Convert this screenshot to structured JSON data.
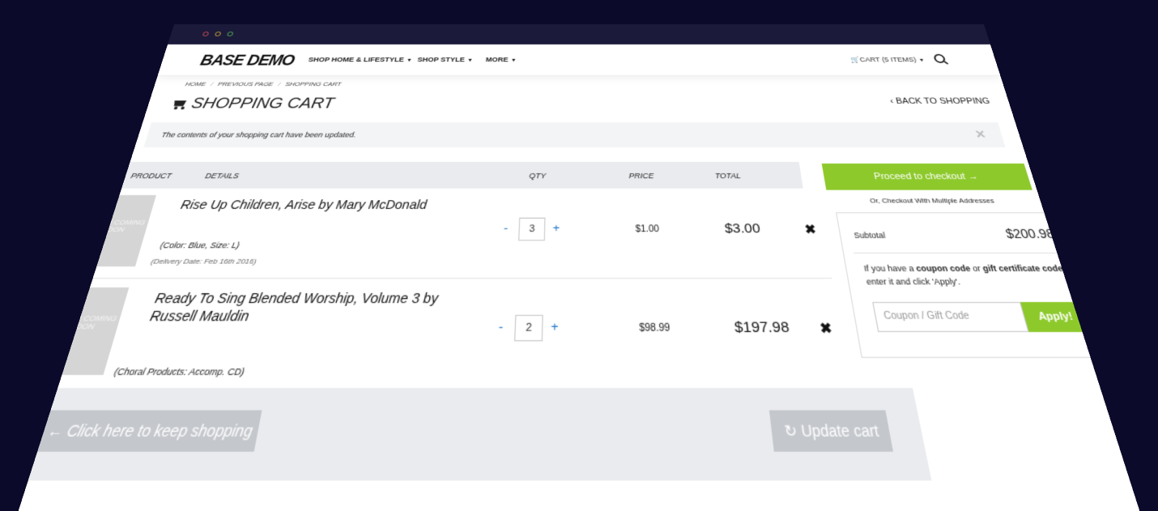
{
  "window": {
    "controls": [
      "close",
      "minimize",
      "maximize"
    ]
  },
  "nav": {
    "logo": "BASE DEMO",
    "items": [
      {
        "label": "SHOP HOME & LIFESTYLE"
      },
      {
        "label": "SHOP STYLE"
      },
      {
        "label": "MORE"
      }
    ],
    "cart_label": "CART (5 ITEMS)",
    "search_icon": "search-icon"
  },
  "breadcrumb": [
    "HOME",
    "PREVIOUS PAGE",
    "SHOPPING CART"
  ],
  "page": {
    "title": "SHOPPING CART",
    "back_label": "BACK TO SHOPPING"
  },
  "alert": {
    "text": "The contents of your shopping cart have been updated.",
    "close_glyph": "✕"
  },
  "table": {
    "headers": {
      "product": "PRODUCT",
      "details": "DETAILS",
      "qty": "QTY",
      "price": "PRICE",
      "total": "TOTAL"
    },
    "rows": [
      {
        "thumb_text": "PHOTO COMING SOON",
        "name": "Rise Up Children, Arise by Mary McDonald",
        "options": "(Color: Blue, Size: L)",
        "delivery": "(Delivery Date: Feb 16th 2016)",
        "qty": "3",
        "price": "$1.00",
        "total": "$3.00"
      },
      {
        "thumb_text": "PHOTO COMING SOON",
        "name": "Ready To Sing Blended Worship, Volume 3 by Russell Mauldin",
        "options": "(Choral Products: Accomp. CD)",
        "qty": "2",
        "price": "$98.99",
        "total": "$197.98"
      }
    ],
    "qty_minus": "-",
    "qty_plus": "+",
    "remove_glyph": "✖"
  },
  "actions": {
    "keep_shopping": "Click here to keep shopping",
    "update_cart": "Update cart"
  },
  "summary": {
    "checkout_label": "Proceed to checkout",
    "multi_address": "Or, Checkout With Multiple Addresses",
    "subtotal_label": "Subtotal",
    "subtotal_value": "$200.98",
    "coupon_text_1": "If you have a ",
    "coupon_bold_1": "coupon code",
    "coupon_text_2": " or ",
    "coupon_bold_2": "gift certificate code",
    "coupon_text_3": ", enter it and click 'Apply'.",
    "coupon_placeholder": "Coupon / Gift Code",
    "apply_label": "Apply!"
  },
  "colors": {
    "accent_green": "#8dc92b",
    "background": "#0b0a2a",
    "link_blue": "#1a73c9"
  }
}
